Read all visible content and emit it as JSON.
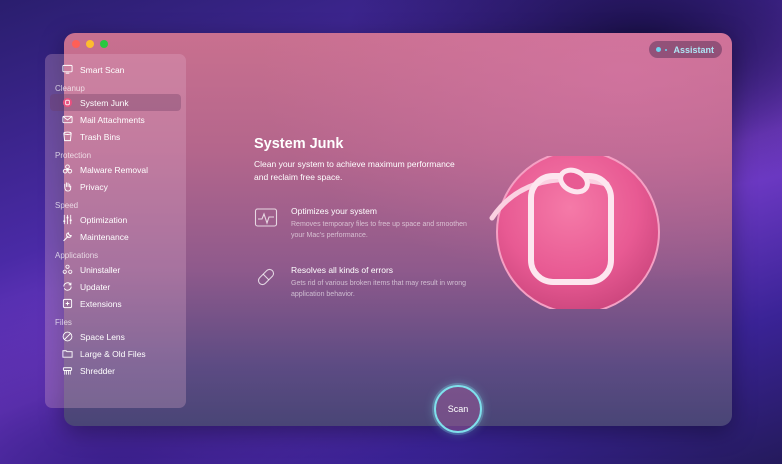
{
  "window": {
    "assistant_label": "Assistant"
  },
  "sidebar": {
    "smart_scan": "Smart Scan",
    "sections": [
      {
        "title": "Cleanup",
        "items": [
          "System Junk",
          "Mail Attachments",
          "Trash Bins"
        ]
      },
      {
        "title": "Protection",
        "items": [
          "Malware Removal",
          "Privacy"
        ]
      },
      {
        "title": "Speed",
        "items": [
          "Optimization",
          "Maintenance"
        ]
      },
      {
        "title": "Applications",
        "items": [
          "Uninstaller",
          "Updater",
          "Extensions"
        ]
      },
      {
        "title": "Files",
        "items": [
          "Space Lens",
          "Large & Old Files",
          "Shredder"
        ]
      }
    ],
    "active_item": "System Junk"
  },
  "main": {
    "title": "System Junk",
    "description": "Clean your system to achieve maximum performance and reclaim free space.",
    "features": [
      {
        "title": "Optimizes your system",
        "description": "Removes temporary files to free up space and smoothen your Mac's performance.",
        "icon": "chart-wave-icon"
      },
      {
        "title": "Resolves all kinds of errors",
        "description": "Gets rid of various broken items that may result in wrong application behavior.",
        "icon": "pill-icon"
      }
    ],
    "scan_label": "Scan"
  },
  "colors": {
    "accent_cyan": "#7fe0ec",
    "hero_pink": "#e85a93"
  }
}
